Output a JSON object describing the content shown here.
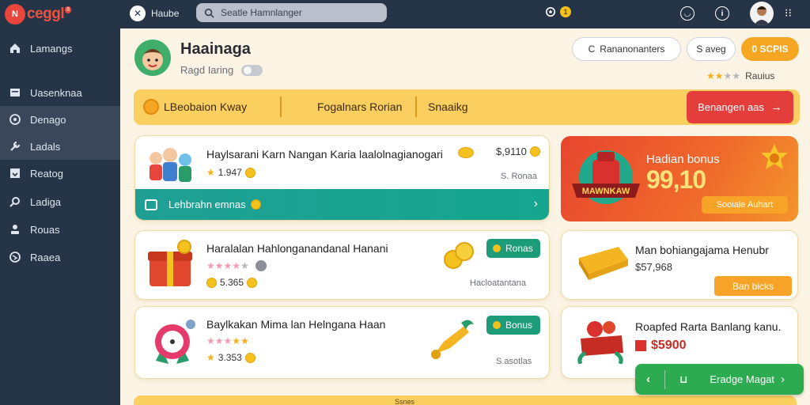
{
  "app": {
    "logo_mark": "N",
    "logo_text": "ceggl",
    "logo_sup": "8"
  },
  "topbar": {
    "home_label": "Haube",
    "search_placeholder": "Seatle Hamnlanger",
    "badge_count": "1"
  },
  "sidebar": {
    "items": [
      {
        "label": "Lamangs",
        "icon": "home-icon"
      },
      {
        "label": "Uasenknaa",
        "icon": "inbox-icon"
      },
      {
        "label": "Denago",
        "icon": "target-icon"
      },
      {
        "label": "Ladals",
        "icon": "wrench-icon"
      },
      {
        "label": "Reatog",
        "icon": "tray-icon"
      },
      {
        "label": "Ladiga",
        "icon": "search-icon"
      },
      {
        "label": "Rouas",
        "icon": "person-icon"
      },
      {
        "label": "Raaea",
        "icon": "globe-icon"
      }
    ]
  },
  "profile": {
    "name": "Haainaga",
    "subtitle": "Ragd Iaring"
  },
  "header_actions": {
    "outline_btn": "Rananonanters",
    "outline_btn_prefix": "C",
    "save_btn": "S aveg",
    "orange_btn": "0 SCPIS",
    "rating_label": "Rauius",
    "rating_value": 2
  },
  "banner": {
    "seg1": "LBeobaion Kway",
    "seg2": "Fogalnars Rorian",
    "seg3": "Snaaikg",
    "cta": "Benangen aas"
  },
  "cards": [
    {
      "title": "Haylsarani Karn Nangan Karia laalolnagianogari",
      "points": "1.947",
      "price": "$,9110",
      "price_sub": "S. Ronaa",
      "footer": "Lehbrahn emnas"
    },
    {
      "title": "Haralalan Hahlonganandanal Hanani",
      "points": "5.365",
      "bonus": "Ronas",
      "sub": "Hacloatantana",
      "rating": 4
    },
    {
      "title": "Baylkakan Mima lan Helngana Haan",
      "points": "3.353",
      "bonus": "Bonus",
      "sub": "S.asotlas",
      "rating": 4
    }
  ],
  "hero": {
    "title": "Hadian bonus",
    "amount": "99,10",
    "ribbon": "MAWNKAW",
    "button": "Sooiale Auhart"
  },
  "side_cards": [
    {
      "title": "Man bohiangajama Henubr",
      "price": "$57,968",
      "button": "Ban bicks"
    },
    {
      "title": "Roapfed Rarta Banlang kanu.",
      "price": "$5900"
    }
  ],
  "floating_bar": {
    "label": "Eradge Magat"
  },
  "bottom_strip": {
    "label": "Ssnes"
  },
  "colors": {
    "nav_bg": "#263447",
    "accent_orange": "#f5a623",
    "accent_red": "#e33e3c",
    "accent_teal": "#1f9f94",
    "accent_green": "#2cab50",
    "banner_yellow": "#fbcf5f"
  }
}
